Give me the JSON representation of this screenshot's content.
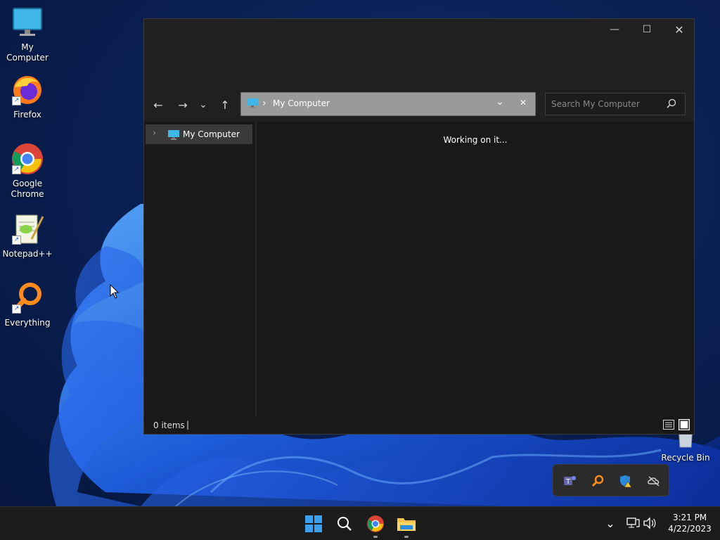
{
  "desktop": {
    "icons": [
      {
        "label": "My Computer"
      },
      {
        "label": "Firefox"
      },
      {
        "label": "Google Chrome"
      },
      {
        "label": "Notepad++"
      },
      {
        "label": "Everything"
      },
      {
        "label": "Recycle Bin"
      }
    ]
  },
  "explorer": {
    "window_buttons": {
      "minimize": "—",
      "maximize": "☐",
      "close": "✕"
    },
    "nav": {
      "back": "←",
      "forward": "→",
      "recent": "⌄",
      "up": "↑"
    },
    "address": {
      "separator": "›",
      "location": "My Computer",
      "dropdown": "⌄",
      "clear": "✕"
    },
    "search": {
      "placeholder": "Search My Computer"
    },
    "navpane": {
      "expand": "›",
      "item": "My Computer"
    },
    "content": {
      "status_message": "Working on it..."
    },
    "statusbar": {
      "items_count": "0 items",
      "separator": "|"
    }
  },
  "taskbar": {
    "time": "3:21 PM",
    "date": "4/22/2023",
    "overflow_chevron": "⌄"
  },
  "colors": {
    "accent": "#1a78d4",
    "window_bg": "#191919",
    "titlebar_bg": "#202020",
    "address_bg": "#9a9a9a"
  }
}
